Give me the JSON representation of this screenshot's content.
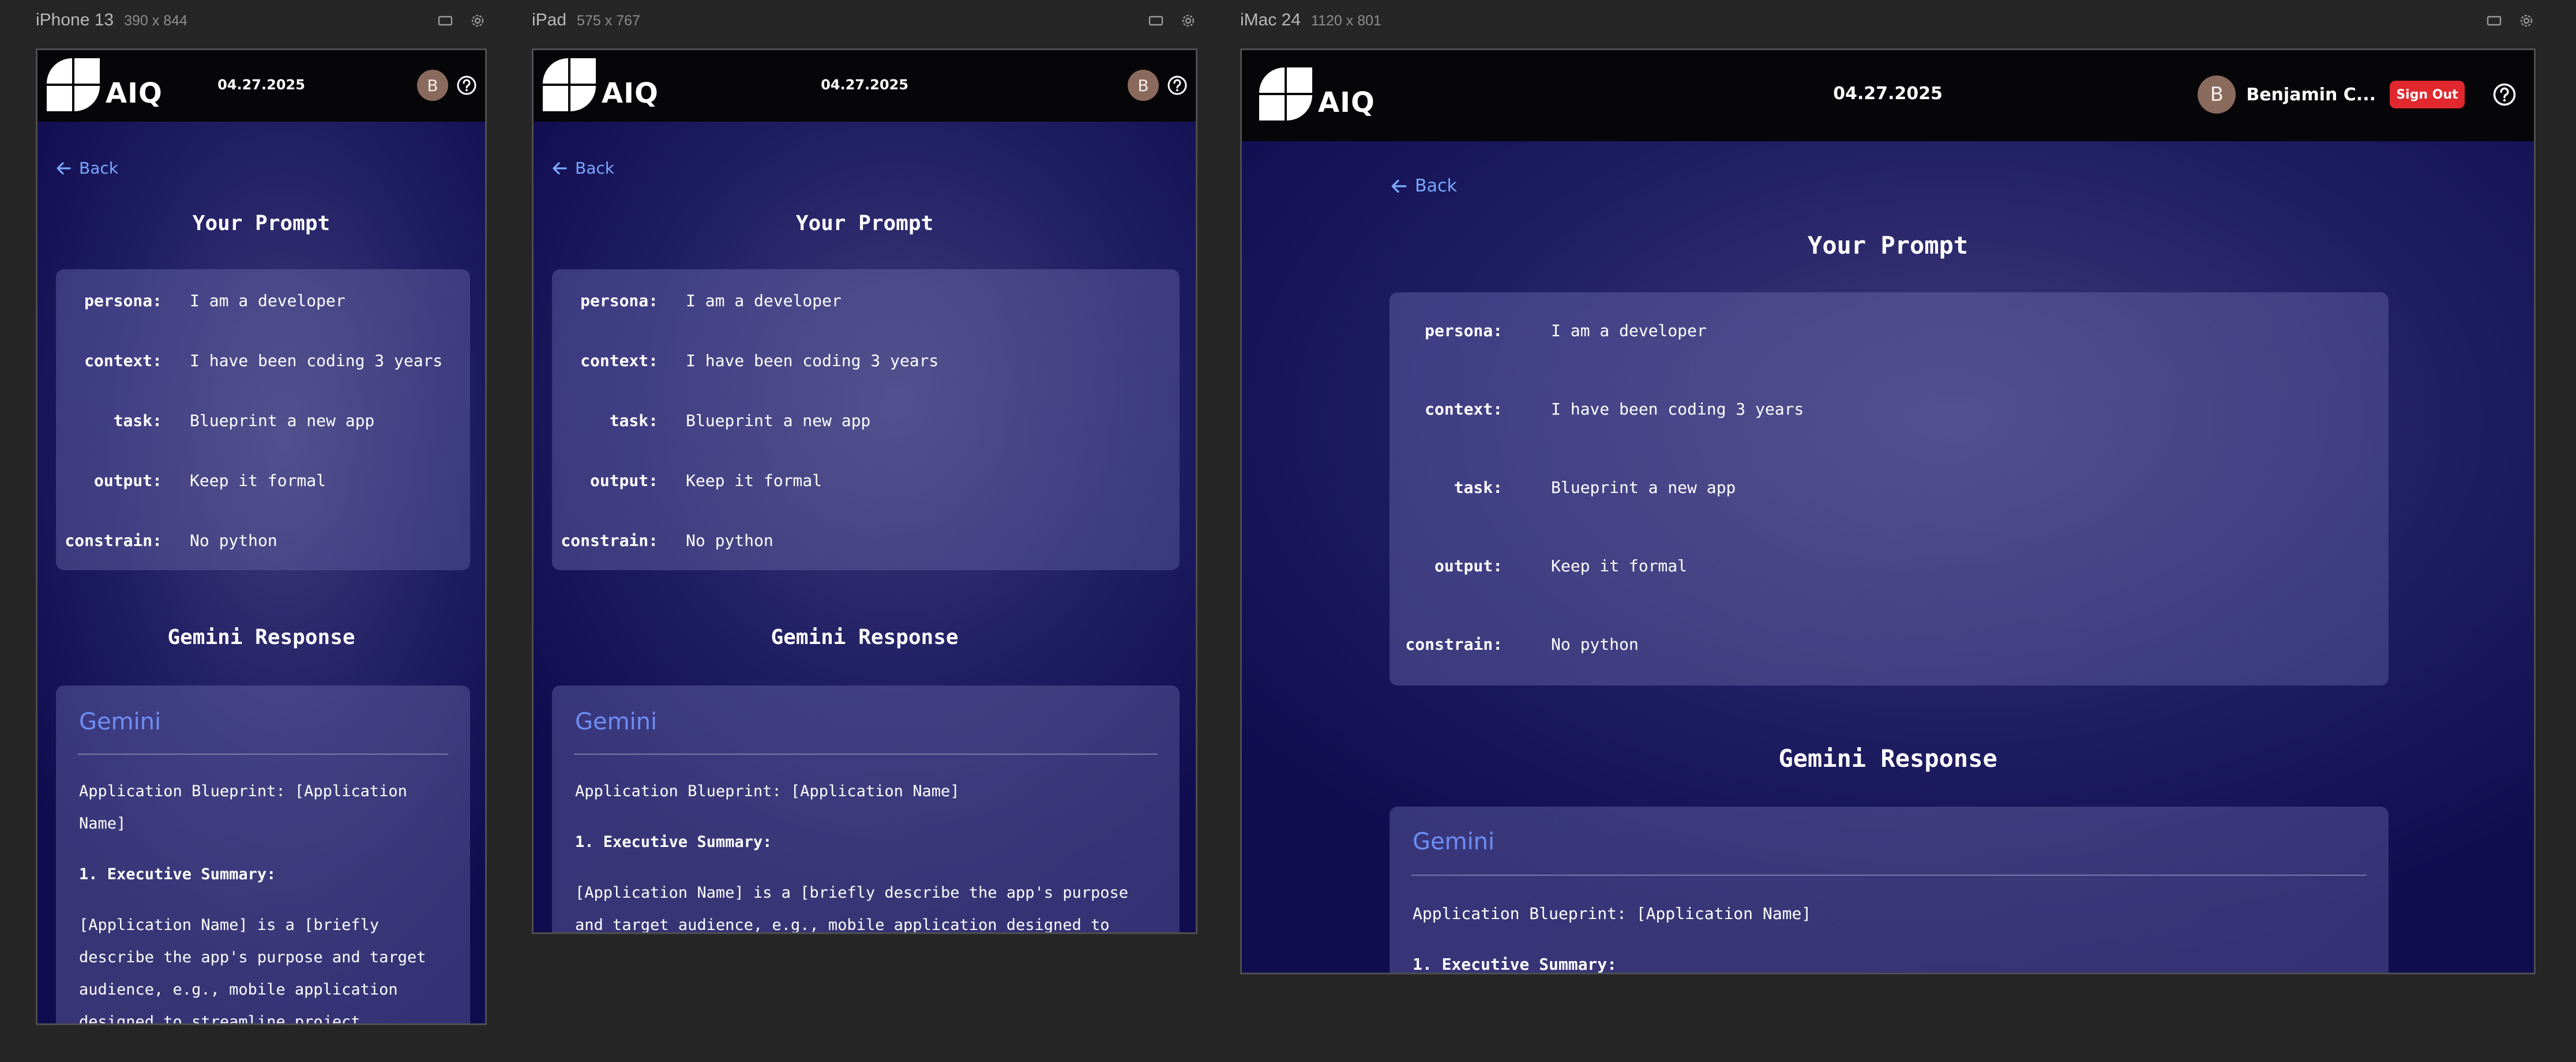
{
  "devices": {
    "iphone": {
      "name": "iPhone 13",
      "size": "390 x 844"
    },
    "ipad": {
      "name": "iPad",
      "size": "575 x 767"
    },
    "imac": {
      "name": "iMac 24",
      "size": "1120 x 801"
    }
  },
  "app": {
    "logo_text": "AIQ",
    "date": "04.27.2025",
    "avatar_initial": "B",
    "user_name": "Benjamin C...",
    "sign_out_label": "Sign Out",
    "back_label": "Back",
    "prompt_title": "Your Prompt",
    "response_title": "Gemini Response",
    "gemini_logo": "Gemini",
    "prompt_fields": [
      {
        "key": "persona:",
        "value": "I am a developer"
      },
      {
        "key": "context:",
        "value": "I have been coding 3 years"
      },
      {
        "key": "task:",
        "value": "Blueprint a new app"
      },
      {
        "key": "output:",
        "value": "Keep it formal"
      },
      {
        "key": "constrain:",
        "value": "No python"
      }
    ],
    "response": {
      "heading": "Application Blueprint: [Application Name]",
      "section1_title": "1. Executive Summary:",
      "summary": "[Application Name] is a [briefly describe the app's purpose and target audience, e.g., mobile application designed to streamline project"
    }
  },
  "icons": {
    "device_toolbar": [
      "rotate-icon",
      "gear-icon"
    ],
    "header": [
      "help-icon"
    ],
    "back": "arrow-left-icon"
  },
  "colors": {
    "canvas": "#262626",
    "header": "#060608",
    "link": "#7aa8ff",
    "sign_out": "#e0282e",
    "gemini": "#6e8ef5"
  }
}
